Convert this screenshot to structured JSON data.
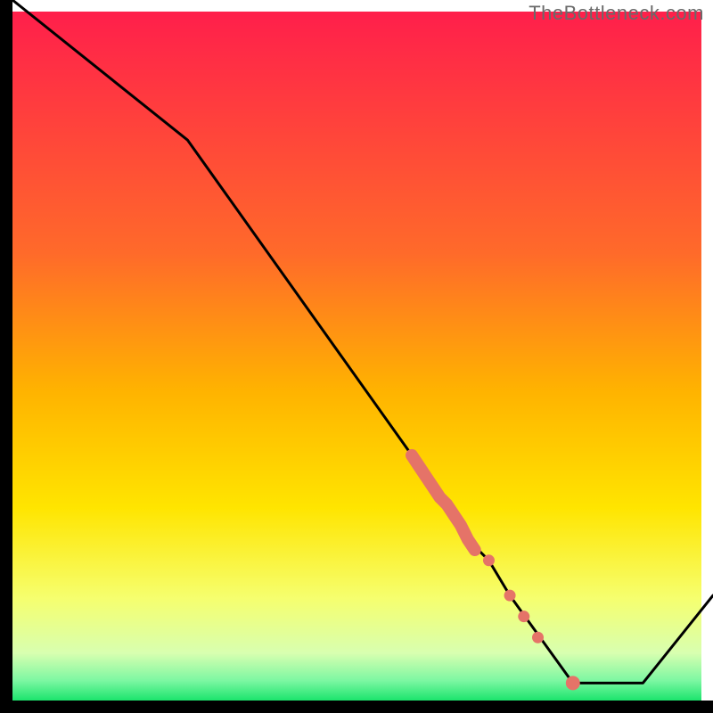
{
  "watermark": "TheBottleneck.com",
  "chart_data": {
    "type": "line",
    "title": "",
    "xlabel": "",
    "ylabel": "",
    "xlim": [
      0,
      100
    ],
    "ylim": [
      0,
      100
    ],
    "grid": false,
    "legend": false,
    "series": [
      {
        "name": "black-curve",
        "x": [
          0,
          25,
          62,
          65,
          68,
          71,
          80,
          90,
          100
        ],
        "y": [
          100,
          80,
          28,
          23,
          20,
          15,
          2.5,
          2.5,
          15
        ]
      }
    ],
    "highlight_points": {
      "name": "salmon-dots",
      "x": [
        57,
        58,
        59,
        60,
        61,
        62,
        63,
        64,
        65,
        66,
        68,
        71,
        73,
        75,
        80
      ],
      "y": [
        35,
        33.5,
        32,
        30.5,
        29,
        28,
        26.5,
        25,
        23,
        21.5,
        20,
        15,
        12,
        9,
        2.5
      ]
    },
    "gradient_stops": [
      {
        "offset": 0.0,
        "color": "#ff1f4b"
      },
      {
        "offset": 0.35,
        "color": "#ff6a2a"
      },
      {
        "offset": 0.55,
        "color": "#ffb300"
      },
      {
        "offset": 0.72,
        "color": "#ffe500"
      },
      {
        "offset": 0.85,
        "color": "#f6ff6e"
      },
      {
        "offset": 0.93,
        "color": "#d8ffb0"
      },
      {
        "offset": 0.97,
        "color": "#7cf7a2"
      },
      {
        "offset": 1.0,
        "color": "#17e36a"
      }
    ],
    "colors": {
      "line": "#000000",
      "dot": "#e57368",
      "axis": "#000000"
    }
  }
}
